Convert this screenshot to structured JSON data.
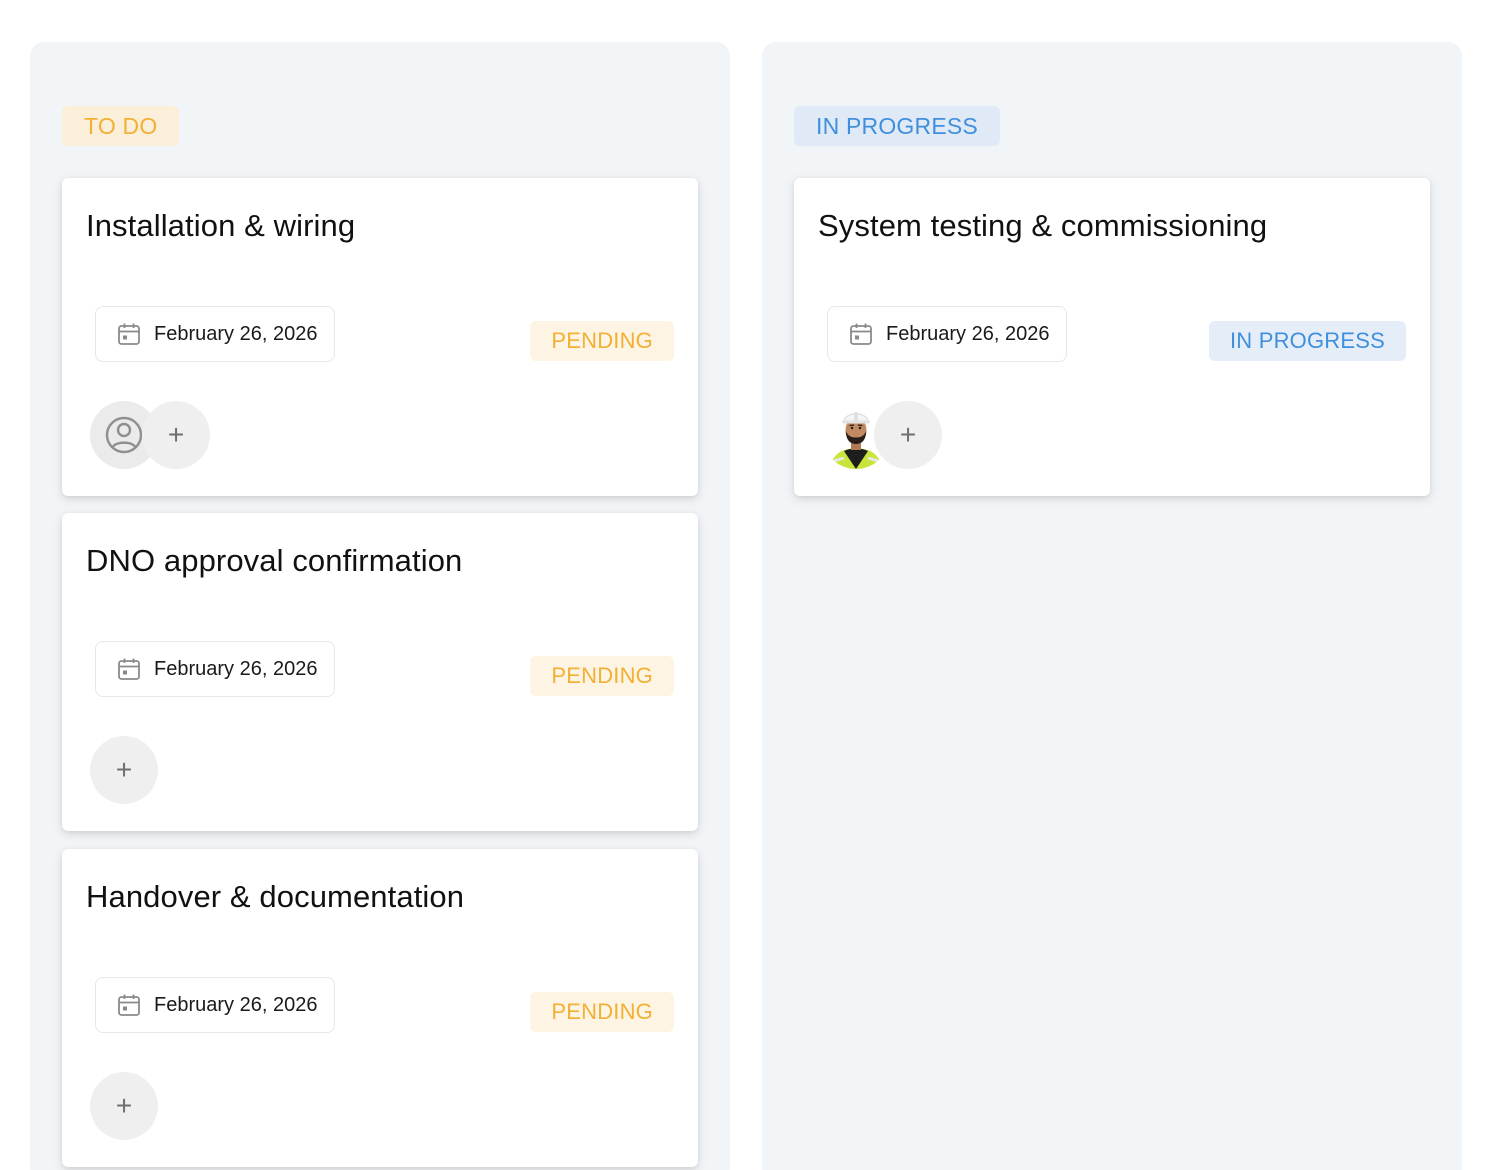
{
  "columns": [
    {
      "label": "TO DO",
      "cards": [
        {
          "title": "Installation & wiring",
          "date": "February 26, 2026",
          "status": "PENDING",
          "assignee": "placeholder"
        },
        {
          "title": "DNO approval confirmation",
          "date": "February 26, 2026",
          "status": "PENDING",
          "assignee": "none"
        },
        {
          "title": "Handover & documentation",
          "date": "February 26, 2026",
          "status": "PENDING",
          "assignee": "none"
        }
      ]
    },
    {
      "label": "IN PROGRESS",
      "cards": [
        {
          "title": "System testing & commissioning",
          "date": "February 26, 2026",
          "status": "IN PROGRESS",
          "assignee": "worker-photo"
        }
      ]
    }
  ],
  "add_symbol": "+",
  "colors": {
    "pending_text": "#f2b035",
    "pending_bg": "#fdf4e4",
    "progress_text": "#3f8fdd",
    "progress_bg": "#e5eef8",
    "column_bg": "#f2f5f8"
  },
  "icons": {
    "date": "calendar-icon",
    "assignee_placeholder": "user-circle-icon",
    "add": "plus-icon"
  }
}
